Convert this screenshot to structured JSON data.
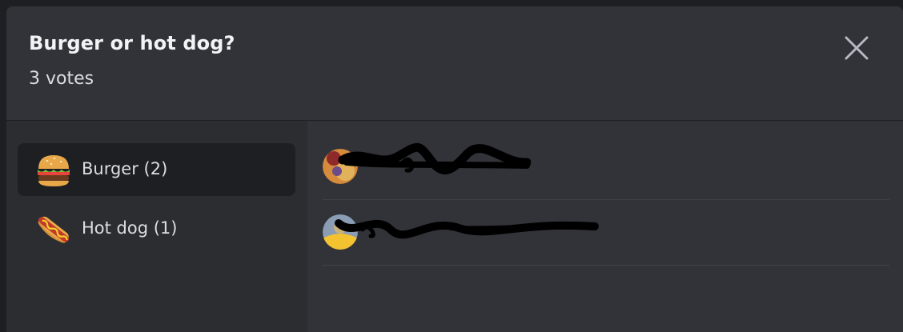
{
  "poll": {
    "question": "Burger or hot dog?",
    "vote_count": "3 votes"
  },
  "answers": [
    {
      "label": "Burger (2)",
      "emoji": "hamburger",
      "selected": true
    },
    {
      "label": "Hot dog (1)",
      "emoji": "hotdog",
      "selected": false
    }
  ],
  "voters": [
    {
      "name": "",
      "redacted": true
    },
    {
      "name": "",
      "redacted": true
    }
  ],
  "icons": {
    "close": "close-icon"
  },
  "colors": {
    "modal_bg": "#313338",
    "sidebar_bg": "#2b2d31",
    "selected_bg": "#1e1f22",
    "text": "#dbdee1",
    "title": "#f2f3f5",
    "close_icon": "#b5bac1"
  }
}
